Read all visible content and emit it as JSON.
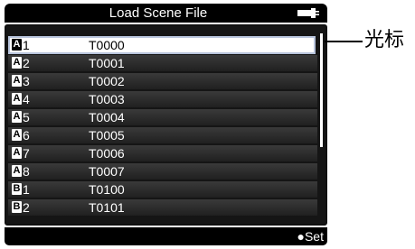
{
  "title": "Load Scene File",
  "battery_icon": "battery-plug-icon",
  "files": [
    {
      "bank": "A",
      "slot": "1",
      "name": "T0000",
      "selected": true
    },
    {
      "bank": "A",
      "slot": "2",
      "name": "T0001"
    },
    {
      "bank": "A",
      "slot": "3",
      "name": "T0002"
    },
    {
      "bank": "A",
      "slot": "4",
      "name": "T0003"
    },
    {
      "bank": "A",
      "slot": "5",
      "name": "T0004"
    },
    {
      "bank": "A",
      "slot": "6",
      "name": "T0005"
    },
    {
      "bank": "A",
      "slot": "7",
      "name": "T0006"
    },
    {
      "bank": "A",
      "slot": "8",
      "name": "T0007"
    },
    {
      "bank": "B",
      "slot": "1",
      "name": "T0100"
    },
    {
      "bank": "B",
      "slot": "2",
      "name": "T0101"
    }
  ],
  "set_button": "●Set",
  "annotation": "光标",
  "colors": {
    "screen_bg": "#151515",
    "selected_bg": "#ffffff",
    "selected_border": "#b8c4dc"
  }
}
